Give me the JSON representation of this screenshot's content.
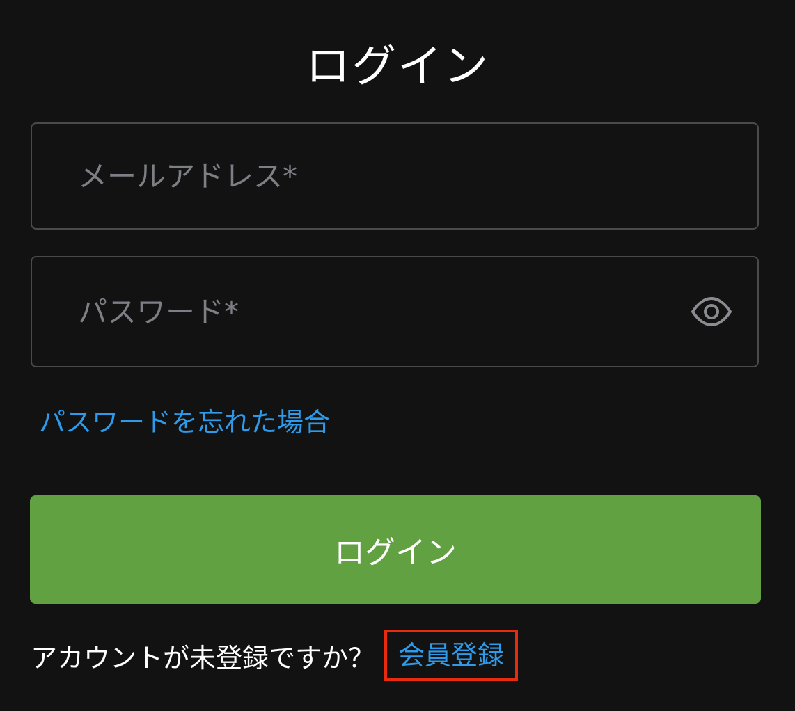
{
  "title": "ログイン",
  "email_field": {
    "placeholder": "メールアドレス*",
    "value": ""
  },
  "password_field": {
    "placeholder": "パスワード*",
    "value": "",
    "toggle_icon": "eye-icon"
  },
  "forgot_password_link": "パスワードを忘れた場合",
  "login_button": "ログイン",
  "signup": {
    "prompt": "アカウントが未登録ですか？",
    "link": "会員登録",
    "highlight_color": "#e82a0f"
  },
  "colors": {
    "background": "#121212",
    "link": "#2e9bea",
    "login_button": "#61a142",
    "field_border": "#4a4a4a"
  }
}
